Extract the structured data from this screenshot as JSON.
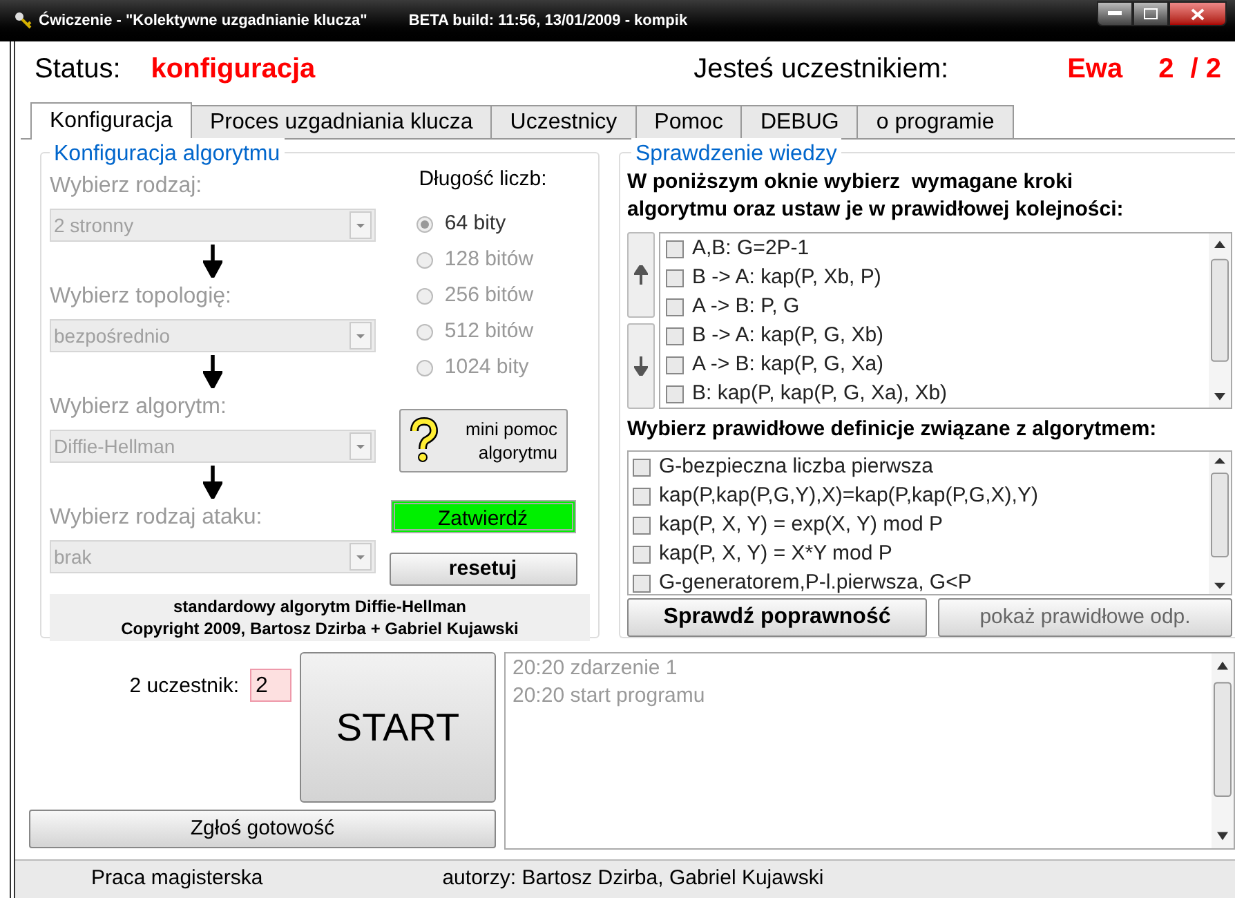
{
  "window": {
    "title": "Ćwiczenie - \"Kolektywne uzgadnianie klucza\"",
    "build_info": "BETA build: 11:56, 13/01/2009 - kompik"
  },
  "status": {
    "label": "Status:",
    "value": "konfiguracja",
    "participant_label": "Jesteś uczestnikiem:",
    "participant_name": "Ewa",
    "participant_index": "2",
    "participant_total": "/ 2"
  },
  "tabs": [
    {
      "label": "Konfiguracja",
      "selected": true
    },
    {
      "label": "Proces uzgadniania klucza",
      "selected": false
    },
    {
      "label": "Uczestnicy",
      "selected": false
    },
    {
      "label": "Pomoc",
      "selected": false
    },
    {
      "label": "DEBUG",
      "selected": false
    },
    {
      "label": "o programie",
      "selected": false
    }
  ],
  "config": {
    "title": "Konfiguracja algorytmu",
    "selects": [
      {
        "label": "Wybierz rodzaj:",
        "value": "2 stronny",
        "disabled": true
      },
      {
        "label": "Wybierz topologię:",
        "value": "bezpośrednio",
        "disabled": true
      },
      {
        "label": "Wybierz algorytm:",
        "value": "Diffie-Hellman",
        "disabled": true
      },
      {
        "label": "Wybierz rodzaj ataku:",
        "value": "brak",
        "disabled": true
      }
    ],
    "bit_length": {
      "label": "Długość liczb:",
      "options": [
        {
          "label": "64 bity",
          "selected": true
        },
        {
          "label": "128 bitów",
          "selected": false
        },
        {
          "label": "256 bitów",
          "selected": false
        },
        {
          "label": "512 bitów",
          "selected": false
        },
        {
          "label": "1024 bity",
          "selected": false
        }
      ]
    },
    "help_button": [
      "mini pomoc",
      "algorytmu"
    ],
    "confirm_button": "Zatwierdź",
    "reset_button": "resetuj",
    "footer": [
      "standardowy algorytm Diffie-Hellman",
      "Copyright 2009, Bartosz Dzirba + Gabriel Kujawski"
    ]
  },
  "knowledge": {
    "title": "Sprawdzenie wiedzy",
    "instruction": "W poniższym oknie wybierz  wymagane kroki algorytmu oraz ustaw je w prawidłowej kolejności:",
    "steps": [
      {
        "label": "A,B: G=2P-1",
        "checked": false
      },
      {
        "label": "B -> A: kap(P, Xb, P)",
        "checked": false
      },
      {
        "label": "A -> B: P, G",
        "checked": false
      },
      {
        "label": "B -> A: kap(P, G, Xb)",
        "checked": false
      },
      {
        "label": "A -> B: kap(P, G, Xa)",
        "checked": false
      },
      {
        "label": "B: kap(P, kap(P, G, Xa), Xb)",
        "checked": false
      }
    ],
    "definitions_label": "Wybierz prawidłowe definicje związane z algorytmem:",
    "definitions": [
      {
        "label": "G-bezpieczna liczba pierwsza",
        "checked": false
      },
      {
        "label": "kap(P,kap(P,G,Y),X)=kap(P,kap(P,G,X),Y)",
        "checked": false
      },
      {
        "label": "kap(P, X, Y) = exp(X, Y) mod P",
        "checked": false
      },
      {
        "label": "kap(P, X, Y) = X*Y mod P",
        "checked": false
      },
      {
        "label": "G-generatorem,P-l.pierwsza, G<P",
        "checked": false
      }
    ],
    "check_button": "Sprawdź poprawność",
    "show_button": {
      "label": "pokaż prawidłowe odp.",
      "disabled": true
    }
  },
  "participant": {
    "label": "2 uczestnik:",
    "value": "2"
  },
  "start_button": "START",
  "ready_button": "Zgłoś gotowość",
  "log": [
    "20:20 zdarzenie 1",
    "20:20 start programu"
  ],
  "status_bar": [
    "Praca magisterska",
    "autorzy: Bartosz Dzirba, Gabriel Kujawski"
  ]
}
